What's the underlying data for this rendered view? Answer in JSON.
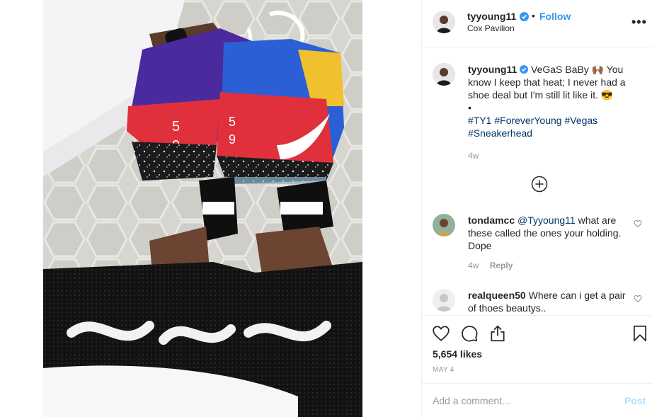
{
  "post": {
    "username": "tyyoung11",
    "verified": true,
    "dot": "•",
    "follow_label": "Follow",
    "location": "Cox Pavilion",
    "more_icon": "more-horizontal-icon"
  },
  "caption": {
    "username": "tyyoung11",
    "text": "VeGaS BaBy 🙌🏾 You know I keep that heat; I never had a shoe deal but I'm still lit like it. 😎",
    "bullet": "•",
    "hashtags": [
      "#TY1",
      "#ForeverYoung",
      "#Vegas",
      "#Sneakerhead"
    ],
    "time": "4w"
  },
  "load_more_icon": "plus-circle-icon",
  "comments": [
    {
      "username": "tondamcc",
      "mention": "@Tyyoung11",
      "text": " what are these called the ones your holding. Dope",
      "time": "4w",
      "reply_label": "Reply"
    },
    {
      "username": "realqueen50",
      "text": "Where can i get a pair of thoes beautys..",
      "time": "",
      "reply_label": ""
    }
  ],
  "actions": {
    "like_icon": "heart-icon",
    "comment_icon": "comment-icon",
    "share_icon": "share-icon",
    "save_icon": "bookmark-icon",
    "likes": "5,654 likes",
    "date": "MAY 4"
  },
  "add_comment": {
    "placeholder": "Add a comment…",
    "post_label": "Post"
  },
  "colors": {
    "link": "#3897f0",
    "hashtag": "#003569",
    "muted": "#999999",
    "post_disabled": "#b2dffc"
  }
}
